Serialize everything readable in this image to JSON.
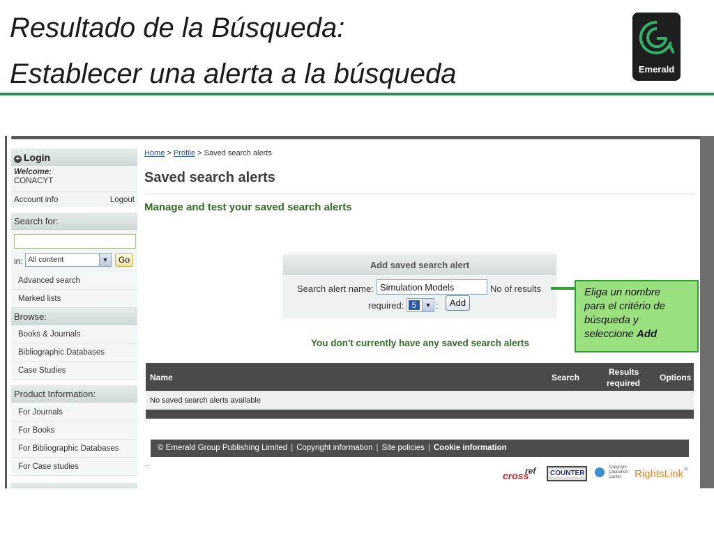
{
  "slide": {
    "title_line1": "Resultado de la Búsqueda:",
    "title_line2": "Establecer una alerta a la búsqueda",
    "logo_text": "Emerald",
    "accent_color": "#2e8b57"
  },
  "sidebar": {
    "login_label": "Login",
    "welcome_label": "Welcome:",
    "user_name": "CONACYT",
    "account_info": "Account info",
    "logout": "Logout",
    "search_for_label": "Search for:",
    "search_placeholder": "",
    "in_label": "in:",
    "content_select_value": "All content",
    "go_button": "Go",
    "search_links": [
      "Advanced search",
      "Marked lists"
    ],
    "browse_label": "Browse:",
    "browse_items": [
      "Books & Journals",
      "Bibliographic Databases",
      "Case Studies"
    ],
    "product_info_label": "Product Information:",
    "product_items": [
      "For Journals",
      "For Books",
      "For Bibliographic Databases",
      "For Case studies"
    ]
  },
  "breadcrumb": {
    "home": "Home",
    "sep1": " > ",
    "profile": "Profile",
    "sep2": " > ",
    "current": "Saved search alerts"
  },
  "main": {
    "title": "Saved search alerts",
    "subtitle": "Manage and test your saved search alerts",
    "add_box": {
      "header": "Add saved search alert",
      "name_label": "Search alert name:",
      "name_value": "Simulation Models",
      "results_label": "No of results",
      "required_label": "required:",
      "results_select_value": "5",
      "colon": ":",
      "add_button": "Add"
    },
    "no_alerts_message": "You don't currently have any saved search alerts",
    "table": {
      "columns": [
        "Name",
        "Search",
        "Results",
        "required",
        "Options"
      ],
      "empty_row": "No saved search alerts available"
    }
  },
  "footer": {
    "copyright": "© Emerald Group Publishing Limited",
    "links": [
      "Copyright information",
      "Site policies",
      "Cookie information"
    ],
    "sep": "|",
    "dots": "..",
    "partners": [
      "cross",
      "ref",
      "COUNTER",
      "Copyright",
      "Clearance",
      "Center",
      "RightsLink",
      "®"
    ]
  },
  "callout": {
    "line1": "Eliga un nombre",
    "line2": "para el critério de",
    "line3": "búsqueda y",
    "line4_prefix": "seleccione ",
    "line4_bold": "Add"
  }
}
